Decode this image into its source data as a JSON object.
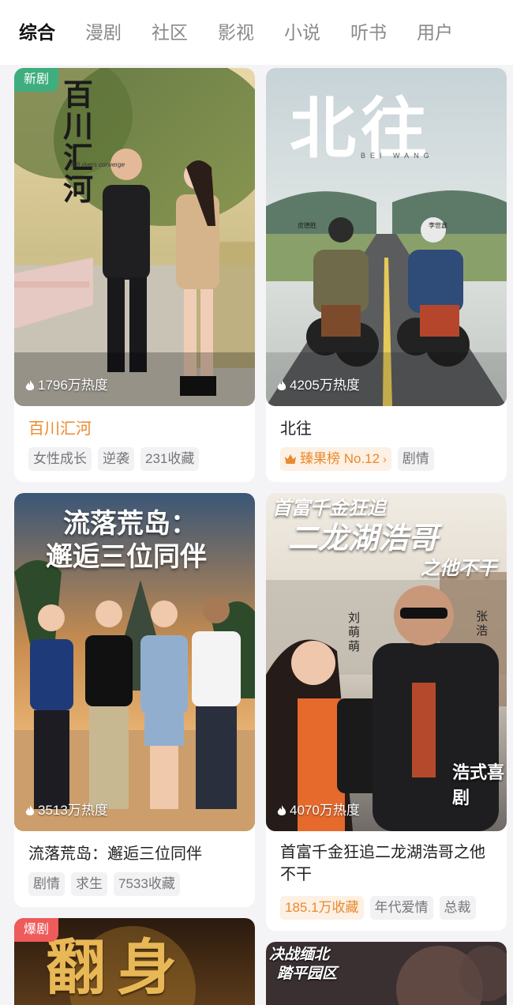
{
  "tabs": [
    "综合",
    "漫剧",
    "社区",
    "影视",
    "小说",
    "听书",
    "用户"
  ],
  "cards": [
    {
      "badge": "新剧",
      "poster_title": "百川汇河",
      "poster_sub": "Hill rivers converge",
      "heat": "1796万热度",
      "title": "百川汇河",
      "tags": [
        "女性成长",
        "逆袭",
        "231收藏"
      ]
    },
    {
      "poster_title": "北往",
      "poster_sub": "BEI WANG",
      "poster_names": [
        "皮德胜",
        "李世鑫"
      ],
      "heat": "4205万热度",
      "title": "北往",
      "rank": "臻果榜 No.12",
      "tags": [
        "剧情"
      ]
    },
    {
      "poster_title_1": "流落荒岛：",
      "poster_title_2": "邂逅三位同伴",
      "heat": "3513万热度",
      "title": "流落荒岛：邂逅三位同伴",
      "tags": [
        "剧情",
        "求生",
        "7533收藏"
      ]
    },
    {
      "poster_title_1": "首富千金狂追",
      "poster_title_2": "二龙湖浩哥",
      "poster_title_3": "之他不干",
      "poster_names": [
        "刘萌萌",
        "张浩"
      ],
      "poster_stamp": "浩式喜剧",
      "heat": "4070万热度",
      "title": "首富千金狂追二龙湖浩哥之他不干",
      "collect": "185.1万收藏",
      "tags": [
        "年代爱情",
        "总裁"
      ]
    },
    {
      "badge": "爆剧",
      "poster_title": "翻身"
    },
    {
      "poster_title_1": "决战缅北",
      "poster_title_2": "踏平园区"
    }
  ],
  "colors": {
    "accent_orange": "#e98a2d",
    "badge_new": "#3fae7f",
    "badge_hot": "#ef5a5a"
  }
}
